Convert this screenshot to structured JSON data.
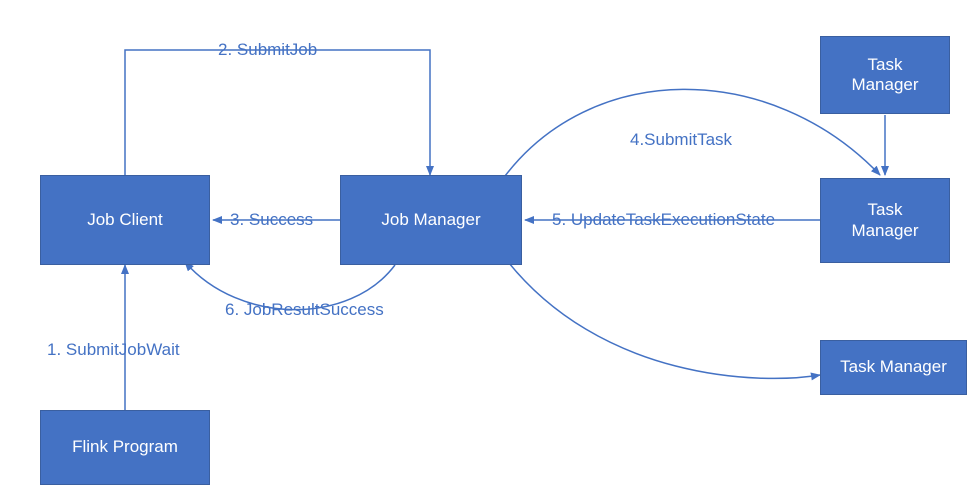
{
  "boxes": {
    "flink_program": "Flink Program",
    "job_client": "Job Client",
    "job_manager": "Job Manager",
    "task_manager_1": "Task\nManager",
    "task_manager_2": "Task\nManager",
    "task_manager_3": "Task Manager"
  },
  "edges": {
    "e1": "1. SubmitJobWait",
    "e2": "2. SubmitJob",
    "e3": "3. Success",
    "e4": "4.SubmitTask",
    "e5": "5. UpdateTaskExecutionState",
    "e6": "6. JobResultSuccess"
  },
  "colors": {
    "box_fill": "#4472C4",
    "text": "#4472C4",
    "stroke": "#4472C4"
  }
}
